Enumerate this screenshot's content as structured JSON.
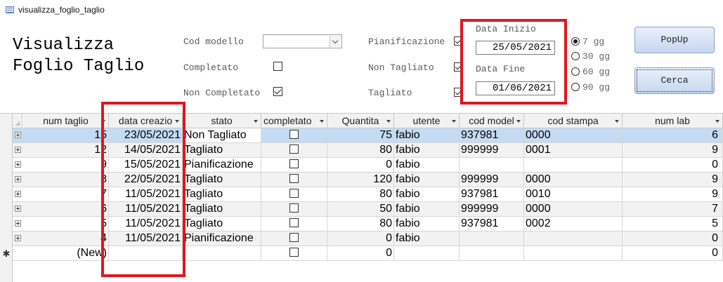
{
  "window": {
    "title": "visualizza_foglio_taglio"
  },
  "form": {
    "title_line1": "Visualizza",
    "title_line2": "Foglio Taglio",
    "cod_modello_label": "Cod modello",
    "cod_modello_value": "",
    "completato_label": "Completato",
    "completato_checked": false,
    "non_completato_label": "Non Completato",
    "non_completato_checked": true,
    "pianificazione_label": "Pianificazione",
    "pianificazione_checked": true,
    "non_tagliato_label": "Non Tagliato",
    "non_tagliato_checked": true,
    "tagliato_label": "Tagliato",
    "tagliato_checked": true,
    "data_inizio_label": "Data Inizio",
    "data_inizio_value": "25/05/2021",
    "data_fine_label": "Data Fine",
    "data_fine_value": "01/06/2021",
    "ranges": [
      {
        "label": "7 gg",
        "selected": true
      },
      {
        "label": "30 gg",
        "selected": false
      },
      {
        "label": "60 gg",
        "selected": false
      },
      {
        "label": "90 gg",
        "selected": false
      }
    ],
    "popup_label": "PopUp",
    "cerca_label": "Cerca"
  },
  "table": {
    "columns": [
      "num taglio",
      "data creazio",
      "stato",
      "completato",
      "Quantita",
      "utente",
      "cod model",
      "cod stampa",
      "num lab"
    ],
    "rows": [
      {
        "num_taglio": "15",
        "data_creazione": "23/05/2021",
        "stato": "Non Tagliato",
        "completato": false,
        "quantita": "75",
        "utente": "fabio",
        "cod_modello": "937981",
        "cod_stampa": "0000",
        "num_lab": "6"
      },
      {
        "num_taglio": "12",
        "data_creazione": "14/05/2021",
        "stato": "Tagliato",
        "completato": false,
        "quantita": "80",
        "utente": "fabio",
        "cod_modello": "999999",
        "cod_stampa": "0001",
        "num_lab": "9"
      },
      {
        "num_taglio": "9",
        "data_creazione": "15/05/2021",
        "stato": "Pianificazione",
        "completato": false,
        "quantita": "0",
        "utente": "fabio",
        "cod_modello": "",
        "cod_stampa": "",
        "num_lab": "0"
      },
      {
        "num_taglio": "8",
        "data_creazione": "22/05/2021",
        "stato": "Tagliato",
        "completato": false,
        "quantita": "120",
        "utente": "fabio",
        "cod_modello": "999999",
        "cod_stampa": "0000",
        "num_lab": "9"
      },
      {
        "num_taglio": "7",
        "data_creazione": "11/05/2021",
        "stato": "Tagliato",
        "completato": false,
        "quantita": "80",
        "utente": "fabio",
        "cod_modello": "937981",
        "cod_stampa": "0010",
        "num_lab": "9"
      },
      {
        "num_taglio": "6",
        "data_creazione": "11/05/2021",
        "stato": "Tagliato",
        "completato": false,
        "quantita": "50",
        "utente": "fabio",
        "cod_modello": "999999",
        "cod_stampa": "0000",
        "num_lab": "7"
      },
      {
        "num_taglio": "5",
        "data_creazione": "11/05/2021",
        "stato": "Tagliato",
        "completato": false,
        "quantita": "80",
        "utente": "fabio",
        "cod_modello": "937981",
        "cod_stampa": "0002",
        "num_lab": "5"
      },
      {
        "num_taglio": "4",
        "data_creazione": "11/05/2021",
        "stato": "Pianificazione",
        "completato": false,
        "quantita": "0",
        "utente": "fabio",
        "cod_modello": "",
        "cod_stampa": "",
        "num_lab": "0"
      }
    ],
    "new_row": {
      "num_taglio": "(New)",
      "quantita": "0",
      "num_lab": "0"
    }
  },
  "colors": {
    "highlight": "#e0161e",
    "selected_row": "#c5dbf3",
    "alt_row": "#f2f2f2"
  }
}
